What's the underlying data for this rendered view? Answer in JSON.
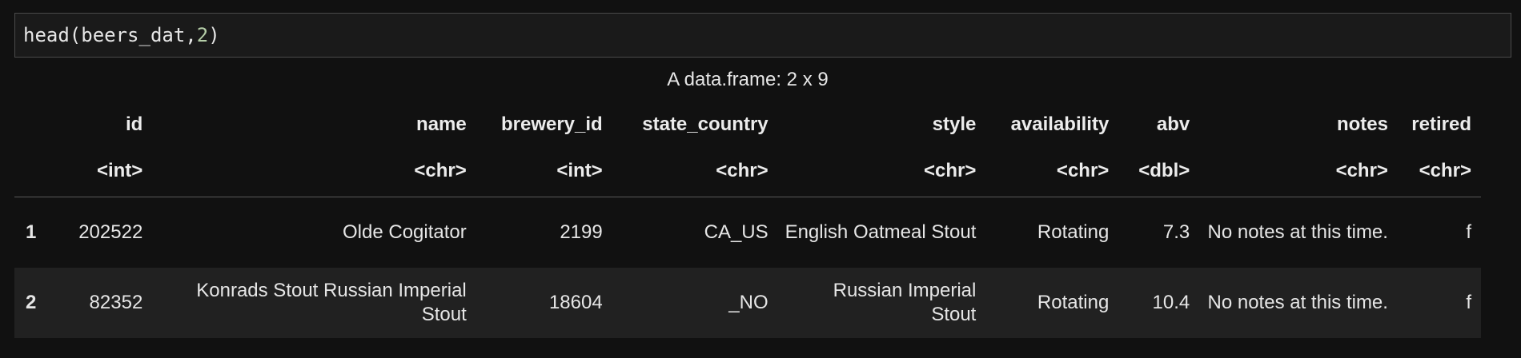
{
  "code_cell": {
    "text_prefix": "head(beers_dat,",
    "text_number": "2",
    "text_suffix": ")"
  },
  "table": {
    "caption": "A data.frame: 2 x 9",
    "columns": [
      {
        "name": "id",
        "type": "<int>"
      },
      {
        "name": "name",
        "type": "<chr>"
      },
      {
        "name": "brewery_id",
        "type": "<int>"
      },
      {
        "name": "state_country",
        "type": "<chr>"
      },
      {
        "name": "style",
        "type": "<chr>"
      },
      {
        "name": "availability",
        "type": "<chr>"
      },
      {
        "name": "abv",
        "type": "<dbl>"
      },
      {
        "name": "notes",
        "type": "<chr>"
      },
      {
        "name": "retired",
        "type": "<chr>"
      }
    ],
    "rows": [
      {
        "index": "1",
        "cells": [
          "202522",
          "Olde Cogitator",
          "2199",
          "CA_US",
          "English Oatmeal Stout",
          "Rotating",
          "7.3",
          "No notes at this time.",
          "f"
        ]
      },
      {
        "index": "2",
        "cells": [
          "82352",
          "Konrads Stout Russian Imperial Stout",
          "18604",
          "_NO",
          "Russian Imperial Stout",
          "Rotating",
          "10.4",
          "No notes at this time.",
          "f"
        ]
      }
    ]
  }
}
